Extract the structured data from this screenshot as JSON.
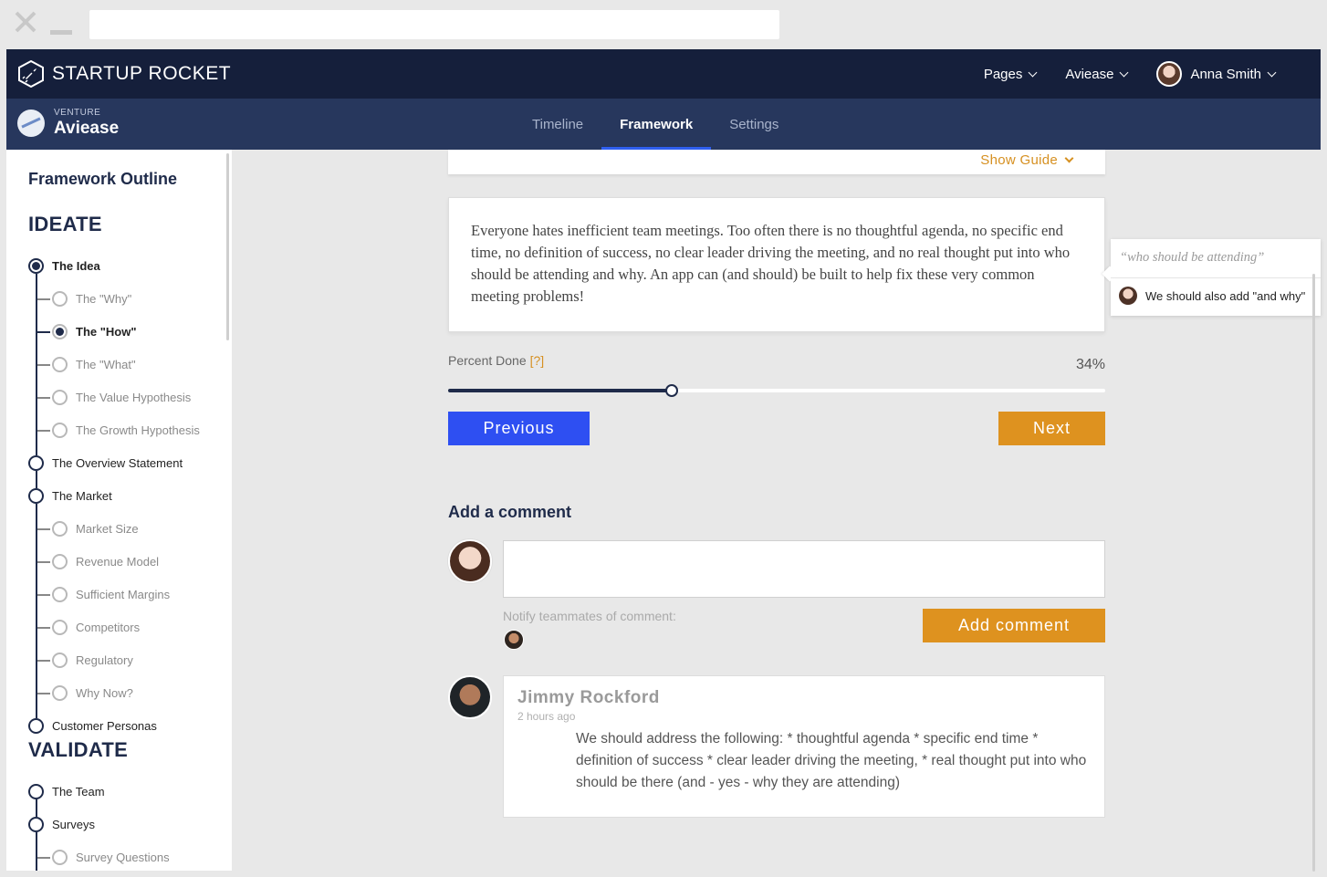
{
  "browser": {
    "url": ""
  },
  "topnav": {
    "brand": "STARTUP ROCKET",
    "menu": [
      {
        "label": "Pages"
      },
      {
        "label": "Aviease"
      },
      {
        "label": "Anna Smith"
      }
    ]
  },
  "subnav": {
    "venture_caption": "VENTURE",
    "venture_name": "Aviease",
    "tabs": [
      {
        "label": "Timeline",
        "active": false
      },
      {
        "label": "Framework",
        "active": true
      },
      {
        "label": "Settings",
        "active": false
      }
    ]
  },
  "sidebar": {
    "title": "Framework Outline",
    "sections": [
      {
        "name": "IDEATE",
        "items": [
          {
            "label": "The Idea",
            "level": 0,
            "selected": true
          },
          {
            "label": "The \"Why\"",
            "level": 1,
            "selected": false
          },
          {
            "label": "The \"How\"",
            "level": 1,
            "selected": true
          },
          {
            "label": "The \"What\"",
            "level": 1,
            "selected": false
          },
          {
            "label": "The Value Hypothesis",
            "level": 1,
            "selected": false
          },
          {
            "label": "The Growth Hypothesis",
            "level": 1,
            "selected": false
          },
          {
            "label": "The Overview Statement",
            "level": 0,
            "selected": false
          },
          {
            "label": "The Market",
            "level": 0,
            "selected": false
          },
          {
            "label": "Market Size",
            "level": 1,
            "selected": false
          },
          {
            "label": "Revenue Model",
            "level": 1,
            "selected": false
          },
          {
            "label": "Sufficient Margins",
            "level": 1,
            "selected": false
          },
          {
            "label": "Competitors",
            "level": 1,
            "selected": false
          },
          {
            "label": "Regulatory",
            "level": 1,
            "selected": false
          },
          {
            "label": "Why Now?",
            "level": 1,
            "selected": false
          },
          {
            "label": "Customer Personas",
            "level": 0,
            "selected": false
          }
        ]
      },
      {
        "name": "VALIDATE",
        "items": [
          {
            "label": "The Team",
            "level": 0,
            "selected": false
          },
          {
            "label": "Surveys",
            "level": 0,
            "selected": false
          },
          {
            "label": "Survey Questions",
            "level": 1,
            "selected": false
          }
        ]
      }
    ]
  },
  "main": {
    "show_guide": "Show Guide",
    "idea_text": "Everyone hates inefficient team meetings. Too often there is no thoughtful agenda, no specific end time, no definition of success, no clear leader driving the meeting, and no real thought put into who should be attending and why. An app can (and should) be built to help fix these very common meeting problems!",
    "annotation": {
      "quote": "who should be attending",
      "comment": "We should also add \"and why\""
    },
    "percent_label": "Percent Done",
    "percent_help": "[?]",
    "percent_value_text": "34%",
    "percent": 34,
    "previous_label": "Previous",
    "next_label": "Next"
  },
  "comments": {
    "title": "Add a comment",
    "input_value": "",
    "notify_label": "Notify teammates of comment:",
    "add_button": "Add comment",
    "items": [
      {
        "author": "Jimmy Rockford",
        "time": "2 hours ago",
        "text": "We should address the following: * thoughtful agenda * specific end time * definition of success * clear leader driving the meeting, * real thought put into who should be there (and - yes - why they are attending)"
      }
    ]
  },
  "colors": {
    "navy": "#151f3b",
    "subnav": "#27375d",
    "accent_blue": "#2e4ff2",
    "accent_orange": "#de921f"
  }
}
